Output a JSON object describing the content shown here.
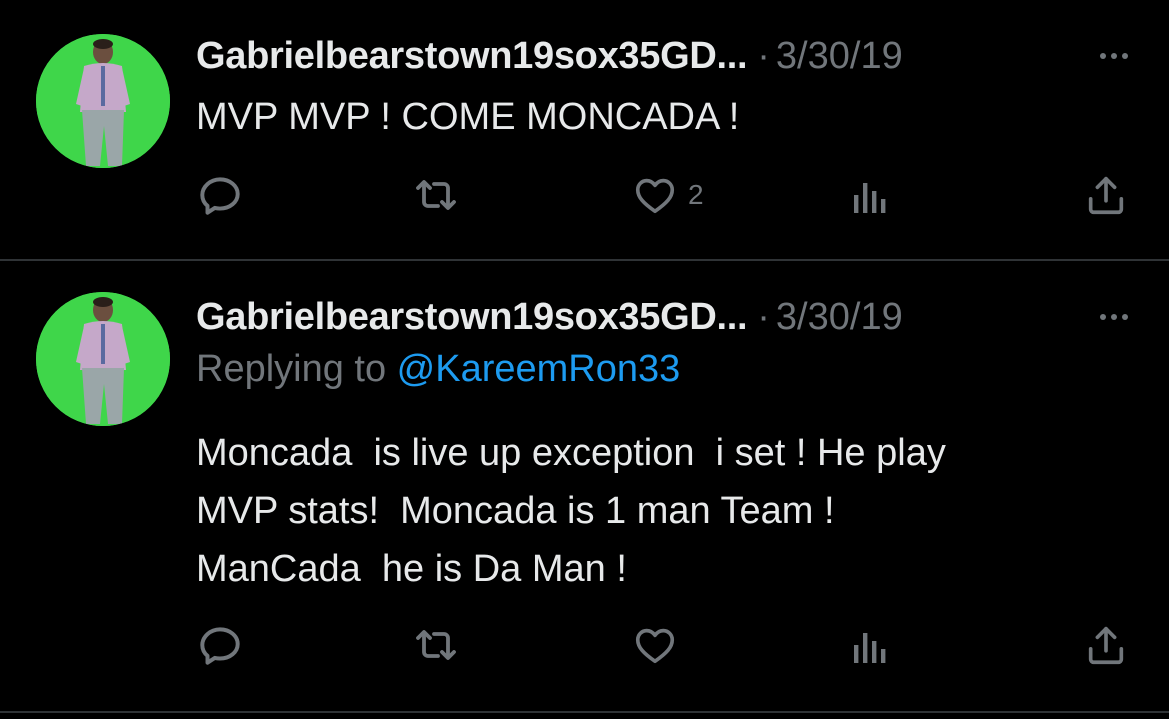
{
  "tweets": [
    {
      "username": "Gabrielbearstown19sox35GD...",
      "separator": "·",
      "date": "3/30/19",
      "text": "MVP MVP ! COME MONCADA !",
      "likes": "2",
      "icons": [
        "reply-icon",
        "retweet-icon",
        "like-icon",
        "views-icon",
        "share-icon",
        "more-icon"
      ]
    },
    {
      "username": "Gabrielbearstown19sox35GD...",
      "separator": "·",
      "date": "3/30/19",
      "replying_prefix": "Replying to ",
      "replying_handle": "@KareemRon33",
      "text": "Moncada  is live up exception  i set ! He play\nMVP stats!  Moncada is 1 man Team !\nManCada  he is Da Man !",
      "icons": [
        "reply-icon",
        "retweet-icon",
        "like-icon",
        "views-icon",
        "share-icon",
        "more-icon"
      ]
    }
  ],
  "colors": {
    "background": "#000000",
    "text_primary": "#e7e9ea",
    "text_secondary": "#71767b",
    "accent": "#1d9bf0",
    "avatar_bg": "#3fd64a",
    "divider": "#2f3336"
  }
}
